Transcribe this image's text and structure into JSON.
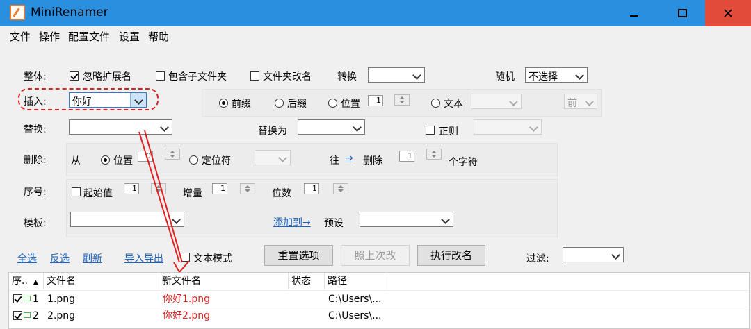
{
  "window": {
    "title": "MiniRenamer"
  },
  "menu": [
    "文件",
    "操作",
    "配置文件",
    "设置",
    "帮助"
  ],
  "overall": {
    "label": "整体:",
    "ignore_ext": "忽略扩展名",
    "include_sub": "包含子文件夹",
    "folder_rename": "文件夹改名",
    "convert_label": "转换",
    "convert_value": "",
    "random_label": "随机",
    "random_value": "不选择"
  },
  "insert": {
    "label": "插入:",
    "value": "你好",
    "prefix": "前缀",
    "suffix": "后缀",
    "position": "位置",
    "position_value": "1",
    "text": "文本",
    "text_value": "",
    "direction_value": "前"
  },
  "replace": {
    "label": "替换:",
    "value": "",
    "replace_with_label": "替换为",
    "replace_with_value": "",
    "regex": "正则",
    "regex_value": ""
  },
  "delete": {
    "label": "删除:",
    "from": "从",
    "position": "位置",
    "position_value": "0",
    "locator": "定位符",
    "direction": "往",
    "arrow": "→",
    "delete": "删除",
    "count": "1",
    "chars": "个字符"
  },
  "sequence": {
    "label": "序号:",
    "start": "起始值",
    "start_value": "1",
    "increment": "增量",
    "increment_value": "1",
    "digits": "位数",
    "digits_value": "1"
  },
  "template": {
    "label": "模板:",
    "value": "",
    "add_to": "添加到→",
    "preset": "预设",
    "preset_value": ""
  },
  "toolbar": {
    "select_all": "全选",
    "invert": "反选",
    "refresh": "刷新",
    "import_export": "导入导出",
    "text_mode": "文本模式",
    "reset": "重置选项",
    "as_last": "照上次改",
    "execute": "执行改名",
    "filter_label": "过滤:",
    "filter_value": ""
  },
  "table": {
    "headers": [
      "序..",
      "文件名",
      "新文件名",
      "状态",
      "路径"
    ],
    "rows": [
      {
        "index": "1",
        "name": "1.png",
        "new_name": "你好1.png",
        "status": "",
        "path": "C:\\Users\\..."
      },
      {
        "index": "2",
        "name": "2.png",
        "new_name": "你好2.png",
        "status": "",
        "path": "C:\\Users\\..."
      }
    ]
  },
  "colors": {
    "titlebar": "#2b8fe0",
    "close": "#e14b3a",
    "highlight": "#e02020",
    "link": "#1b62c2"
  }
}
